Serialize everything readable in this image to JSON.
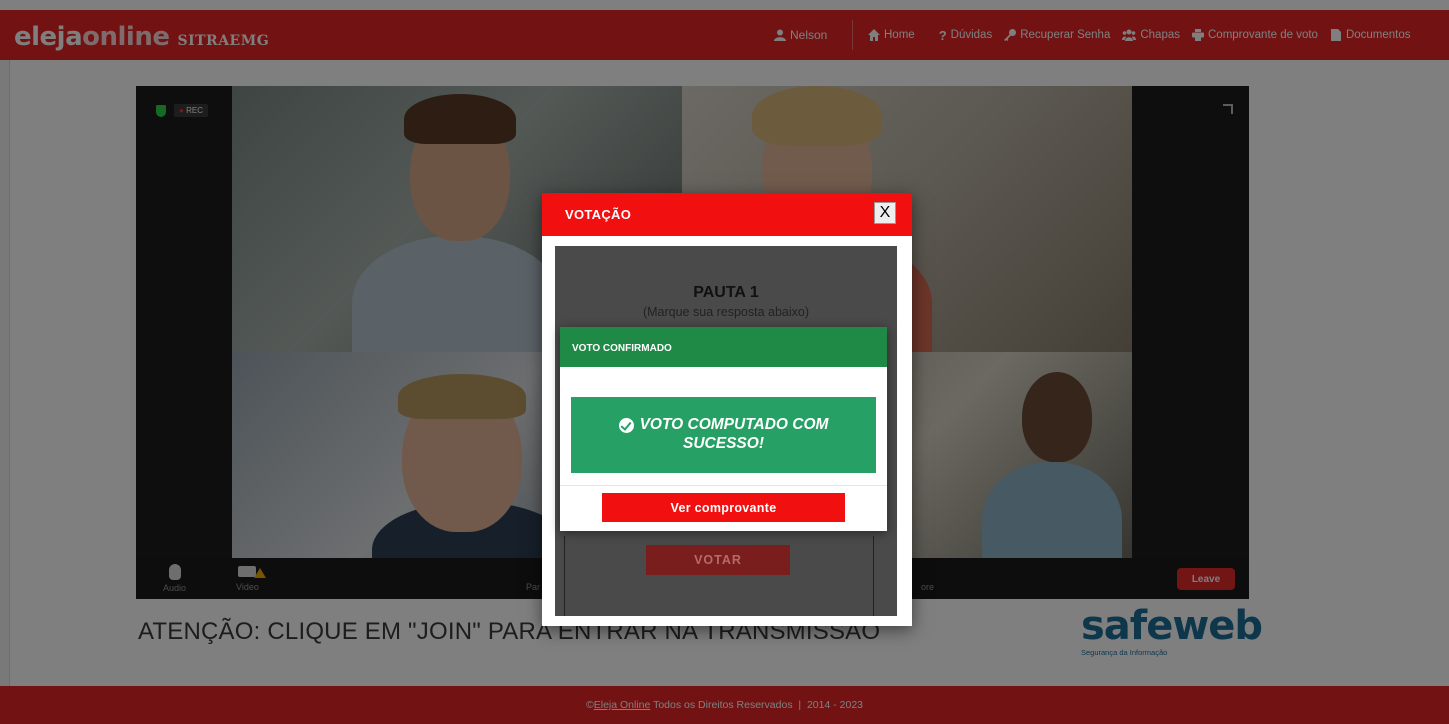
{
  "navbar": {
    "logo_part1": "eleja",
    "logo_part2": "online",
    "org": "SITRAEMG",
    "user": "Nelson",
    "links": {
      "home": "Home",
      "duvidas": "Dúvidas",
      "recuperar": "Recuperar Senha",
      "chapas": "Chapas",
      "comprovante": "Comprovante de voto",
      "documentos": "Documentos"
    },
    "color": "#e42525"
  },
  "video": {
    "rec_label": "REC",
    "audio_label": "Audio",
    "video_label": "Video",
    "participants_partial": "Par",
    "more_partial": "ore",
    "leave_label": "Leave"
  },
  "attention": "ATENÇÃO: CLIQUE EM \"JOIN\" PARA ENTRAR NA TRANSMISSÃO",
  "safeweb": {
    "name": "safeweb",
    "tagline": "Segurança da Informação"
  },
  "footer": {
    "prefix": "©",
    "link": "Eleja Online",
    "text": " Todos os Direitos Reservados  |  2014 - 2023"
  },
  "modal": {
    "title": "VOTAÇÃO",
    "close": "X",
    "ballot_title": "PAUTA 1",
    "ballot_subtitle": "(Marque sua resposta abaixo)",
    "vote_button": "VOTAR",
    "header_color": "#f20f0f"
  },
  "confirm": {
    "title": "VOTO CONFIRMADO",
    "message_line1": "VOTO COMPUTADO COM",
    "message_line2": "SUCESSO!",
    "receipt_button": "Ver comprovante",
    "header_color": "#1e8a45",
    "success_color": "#26a065"
  }
}
